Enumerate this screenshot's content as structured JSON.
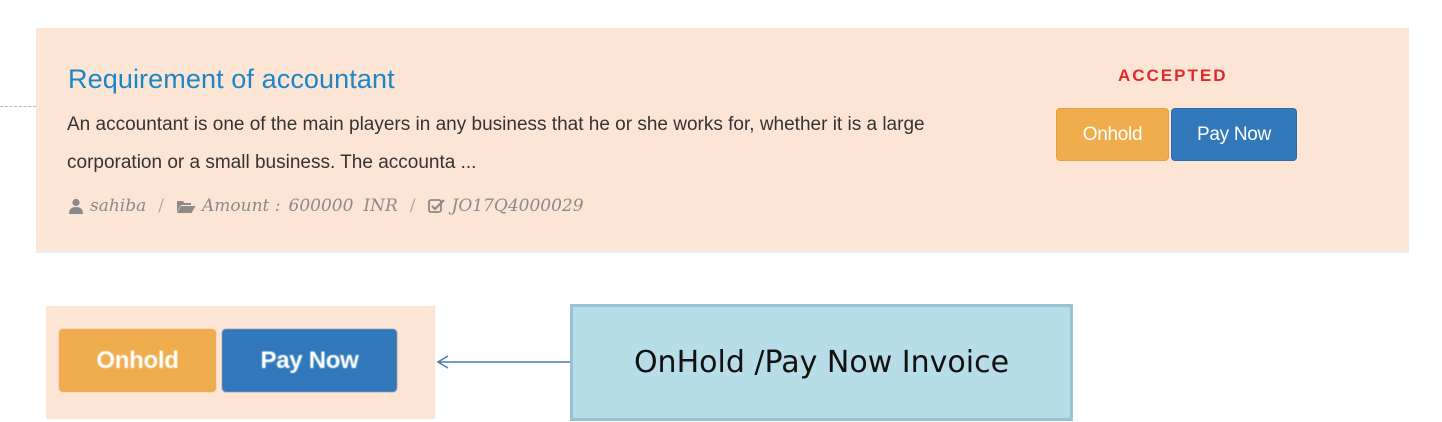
{
  "job": {
    "title": "Requirement of accountant",
    "description": "An accountant is one of the main players in any business that he or she works for, whether it is a large corporation or a small business. The accounta ...",
    "status": "ACCEPTED",
    "meta": {
      "user": "sahiba",
      "amount_label": "Amount :",
      "amount_value": "600000",
      "currency": "INR",
      "job_id": "JO17Q4000029",
      "separator": "/"
    },
    "buttons": {
      "onhold": "Onhold",
      "paynow": "Pay Now"
    }
  },
  "zoom": {
    "onhold": "Onhold",
    "paynow": "Pay Now"
  },
  "callout": {
    "text": "OnHold /Pay Now Invoice"
  },
  "icons": {
    "user": "user-icon",
    "folder": "folder-open-icon",
    "check": "check-square-icon",
    "arrow": "left-arrow-icon"
  },
  "colors": {
    "card_bg": "#fde5d6",
    "title": "#1b86c8",
    "status": "#e02a2a",
    "onhold": "#efad4d",
    "paynow": "#3279bb",
    "callout_bg": "#b7dde9"
  }
}
